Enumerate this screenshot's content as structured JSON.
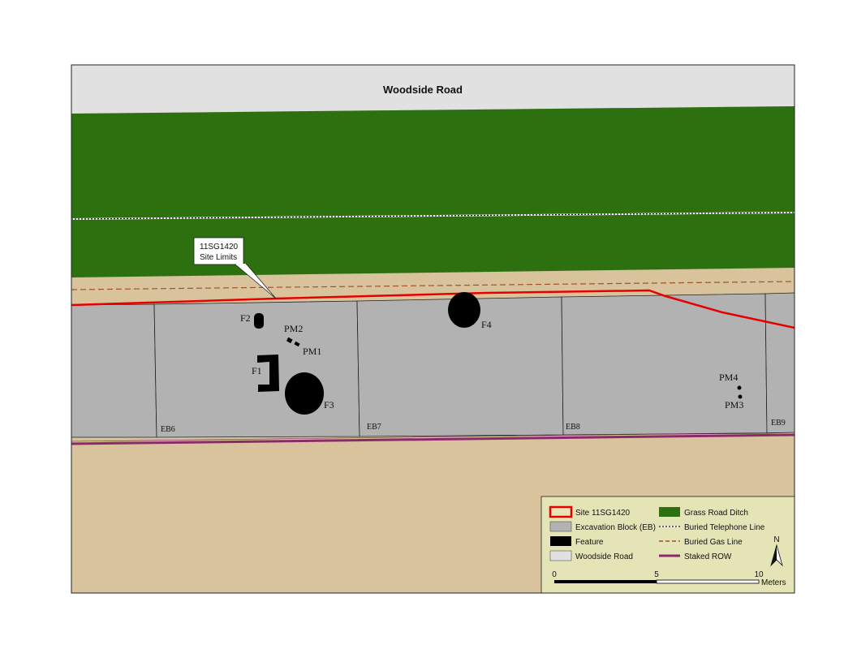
{
  "map": {
    "road_label": "Woodside Road",
    "callout": {
      "line1": "11SG1420",
      "line2": "Site Limits"
    },
    "features": [
      "F1",
      "F2",
      "F3",
      "F4"
    ],
    "post_molds": [
      "PM1",
      "PM2",
      "PM3",
      "PM4"
    ],
    "excavation_blocks": [
      "EB6",
      "EB7",
      "EB8",
      "EB9"
    ]
  },
  "colors": {
    "road": "#e1e1e1",
    "grass": "#2d7010",
    "ground": "#d8c39d",
    "excavation_block": "#b2b2b2",
    "feature": "#000000",
    "site_limit": "#e60000",
    "gas_line": "#a0522d",
    "telephone_line": "#ffff00",
    "staked_row": "#8b2a6b",
    "legend_bg": "#e4e4b6"
  },
  "legend": {
    "items": [
      {
        "label": "Site 11SG1420",
        "icon": "red-outline-box-icon"
      },
      {
        "label": "Grass Road Ditch",
        "icon": "green-box-icon"
      },
      {
        "label": "Excavation Block (EB)",
        "icon": "gray-box-icon"
      },
      {
        "label": "Buried Telephone Line",
        "icon": "dotted-line-icon"
      },
      {
        "label": "Feature",
        "icon": "black-box-icon"
      },
      {
        "label": "Buried Gas Line",
        "icon": "dashed-line-icon"
      },
      {
        "label": "Woodside Road",
        "icon": "light-gray-box-icon"
      },
      {
        "label": "Staked ROW",
        "icon": "purple-line-icon"
      }
    ],
    "north_label": "N",
    "scale": {
      "ticks": [
        "0",
        "5",
        "10"
      ],
      "unit": "Meters"
    }
  }
}
